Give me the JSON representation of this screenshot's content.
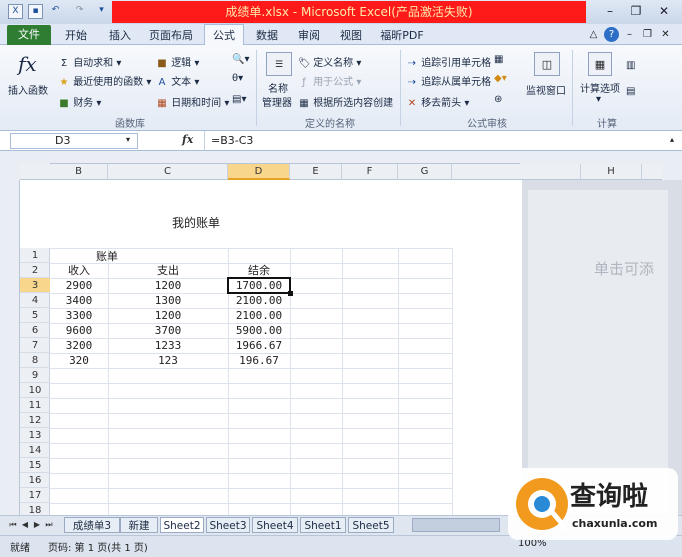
{
  "title_bar": {
    "title": "成绩单.xlsx - Microsoft Excel(产品激活失败)"
  },
  "tabs": {
    "file": "文件",
    "items": [
      "开始",
      "插入",
      "页面布局",
      "公式",
      "数据",
      "审阅",
      "视图",
      "福昕PDF"
    ],
    "active": "公式"
  },
  "ribbon": {
    "function_library": {
      "insert_function": "插入函数",
      "autosum": "自动求和",
      "recent": "最近使用的函数",
      "financial": "财务",
      "logical": "逻辑",
      "text": "文本",
      "datetime": "日期和时间",
      "label": "函数库"
    },
    "defined_names": {
      "name_manager_1": "名称",
      "name_manager_2": "管理器",
      "define_name": "定义名称",
      "use_in_formula": "用于公式",
      "create_from_selection": "根据所选内容创建",
      "label": "定义的名称"
    },
    "formula_auditing": {
      "trace_precedents": "追踪引用单元格",
      "trace_dependents": "追踪从属单元格",
      "remove_arrows": "移去箭头",
      "watch_window": "监视窗口",
      "label": "公式审核"
    },
    "calculation": {
      "options": "计算选项",
      "label": "计算"
    }
  },
  "formula_bar": {
    "name_box": "D3",
    "fx": "fx",
    "formula": "=B3-C3"
  },
  "columns": [
    "B",
    "C",
    "D",
    "E",
    "F",
    "G",
    "H"
  ],
  "active_column": "D",
  "sheet": {
    "page_title": "我的账单",
    "row_numbers": [
      "1",
      "2",
      "3",
      "4",
      "5",
      "6",
      "7",
      "8",
      "9",
      "10",
      "11",
      "12",
      "13",
      "14",
      "15",
      "16",
      "17",
      "18"
    ],
    "active_row": "3",
    "a1_label": "账单",
    "headers": [
      "收入",
      "支出",
      "结余"
    ],
    "rows": [
      [
        "2900",
        "1200",
        "1700.00"
      ],
      [
        "3400",
        "1300",
        "2100.00"
      ],
      [
        "3300",
        "1200",
        "2100.00"
      ],
      [
        "9600",
        "3700",
        "5900.00"
      ],
      [
        "3200",
        "1233",
        "1966.67"
      ],
      [
        "320",
        "123",
        "196.67"
      ]
    ],
    "side_hint": "单击可添"
  },
  "sheet_tabs": [
    "成绩单3",
    "新建",
    "Sheet2",
    "Sheet3",
    "Sheet4",
    "Sheet1",
    "Sheet5"
  ],
  "status": {
    "ready": "就绪",
    "page": "页码: 第 1 页(共 1 页)",
    "zoom": "100%"
  },
  "watermark": {
    "brand": "查询啦",
    "url": "chaxunla.com"
  }
}
